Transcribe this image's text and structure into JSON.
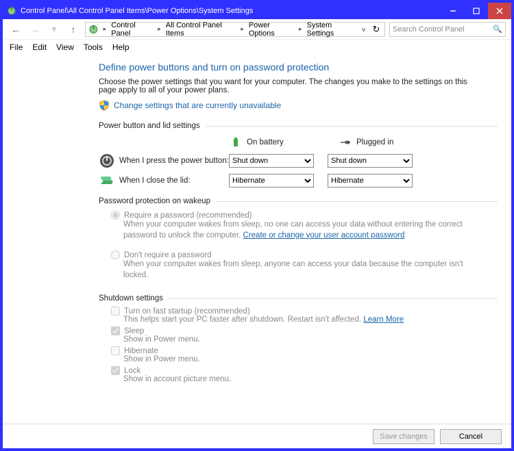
{
  "title": "Control Panel\\All Control Panel Items\\Power Options\\System Settings",
  "breadcrumb": [
    "Control Panel",
    "All Control Panel Items",
    "Power Options",
    "System Settings"
  ],
  "search_placeholder": "Search Control Panel",
  "menu": {
    "file": "File",
    "edit": "Edit",
    "view": "View",
    "tools": "Tools",
    "help": "Help"
  },
  "page": {
    "heading": "Define power buttons and turn on password protection",
    "description": "Choose the power settings that you want for your computer. The changes you make to the settings on this page apply to all of your power plans.",
    "uac_link": "Change settings that are currently unavailable"
  },
  "section_buttons": {
    "header": "Power button and lid settings",
    "col_battery": "On battery",
    "col_plugged": "Plugged in",
    "row_power": "When I press the power button:",
    "row_lid": "When I close the lid:",
    "power_battery": "Shut down",
    "power_plugged": "Shut down",
    "lid_battery": "Hibernate",
    "lid_plugged": "Hibernate"
  },
  "section_password": {
    "header": "Password protection on wakeup",
    "opt1_label": "Require a password (recommended)",
    "opt1_desc_a": "When your computer wakes from sleep, no one can access your data without entering the correct password to unlock the computer. ",
    "opt1_link": "Create or change your user account password",
    "opt2_label": "Don't require a password",
    "opt2_desc": "When your computer wakes from sleep, anyone can access your data because the computer isn't locked."
  },
  "section_shutdown": {
    "header": "Shutdown settings",
    "fast_label": "Turn on fast startup (recommended)",
    "fast_desc": "This helps start your PC faster after shutdown. Restart isn't affected. ",
    "fast_link": "Learn More",
    "sleep_label": "Sleep",
    "sleep_desc": "Show in Power menu.",
    "hibernate_label": "Hibernate",
    "hibernate_desc": "Show in Power menu.",
    "lock_label": "Lock",
    "lock_desc": "Show in account picture menu."
  },
  "footer": {
    "save": "Save changes",
    "cancel": "Cancel"
  }
}
